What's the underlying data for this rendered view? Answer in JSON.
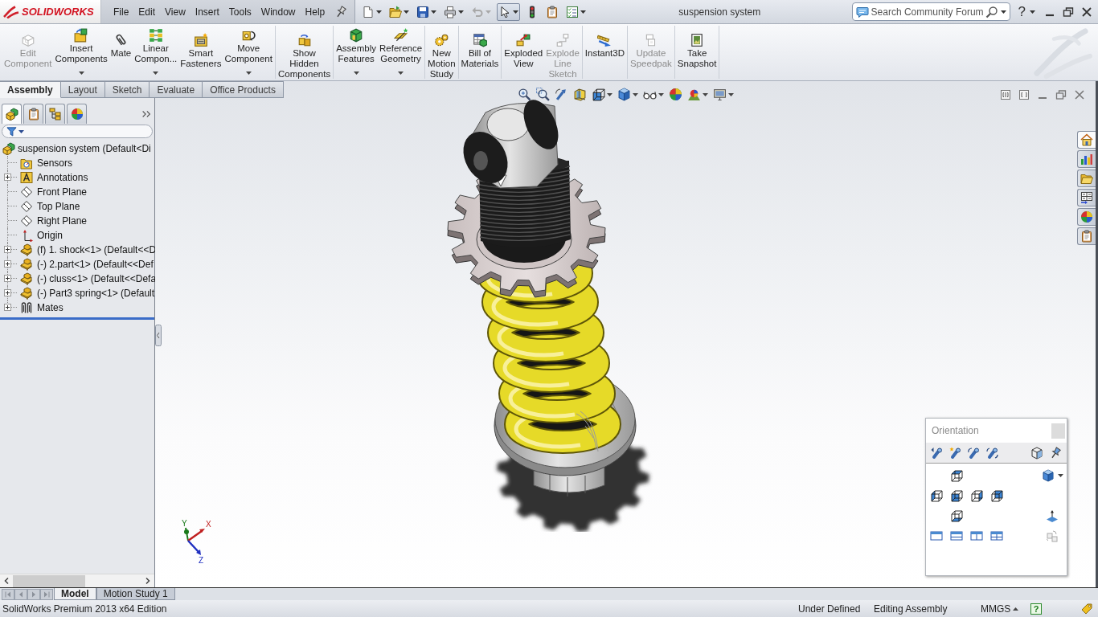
{
  "window": {
    "logo": "SOLIDWORKS",
    "title": "suspension system",
    "help": "?"
  },
  "menu": [
    "File",
    "Edit",
    "View",
    "Insert",
    "Tools",
    "Window",
    "Help"
  ],
  "quick_access": [
    {
      "kind": "new",
      "dropdown": true,
      "disabled": false,
      "pressed": false
    },
    {
      "kind": "open",
      "dropdown": true,
      "disabled": false,
      "pressed": false
    },
    {
      "kind": "save",
      "dropdown": true,
      "disabled": false,
      "pressed": false
    },
    {
      "kind": "print",
      "dropdown": true,
      "disabled": false,
      "pressed": false
    },
    {
      "kind": "undo",
      "dropdown": true,
      "disabled": true,
      "pressed": false
    },
    {
      "kind": "select",
      "dropdown": true,
      "disabled": false,
      "pressed": true
    },
    {
      "kind": "rebuild",
      "dropdown": false,
      "disabled": false,
      "pressed": false
    },
    {
      "kind": "file-properties",
      "dropdown": false,
      "disabled": false,
      "pressed": false
    },
    {
      "kind": "options",
      "dropdown": true,
      "disabled": false,
      "pressed": false
    }
  ],
  "search": {
    "placeholder": "Search Community Forum"
  },
  "ribbon": {
    "groups": [
      [
        {
          "kind": "edit-component",
          "label": "Edit\nComponent",
          "disabled": true,
          "dropdown": false
        },
        {
          "kind": "insert-components",
          "label": "Insert\nComponents",
          "disabled": false,
          "dropdown": true
        },
        {
          "kind": "mate",
          "label": "Mate",
          "disabled": false,
          "dropdown": false
        },
        {
          "kind": "linear-pattern",
          "label": "Linear\nCompon...",
          "disabled": false,
          "dropdown": true
        },
        {
          "kind": "smart-fasteners",
          "label": "Smart\nFasteners",
          "disabled": false,
          "dropdown": false
        },
        {
          "kind": "move-component",
          "label": "Move\nComponent",
          "disabled": false,
          "dropdown": true
        }
      ],
      [
        {
          "kind": "show-hidden",
          "label": "Show\nHidden\nComponents",
          "disabled": false,
          "dropdown": false
        }
      ],
      [
        {
          "kind": "assembly-features",
          "label": "Assembly\nFeatures",
          "disabled": false,
          "dropdown": true
        },
        {
          "kind": "reference-geometry",
          "label": "Reference\nGeometry",
          "disabled": false,
          "dropdown": true
        }
      ],
      [
        {
          "kind": "new-motion-study",
          "label": "New\nMotion\nStudy",
          "disabled": false,
          "dropdown": false
        }
      ],
      [
        {
          "kind": "bill-of-materials",
          "label": "Bill of\nMaterials",
          "disabled": false,
          "dropdown": false
        }
      ],
      [
        {
          "kind": "exploded-view",
          "label": "Exploded\nView",
          "disabled": false,
          "dropdown": false
        },
        {
          "kind": "explode-line-sketch",
          "label": "Explode\nLine\nSketch",
          "disabled": true,
          "dropdown": false
        }
      ],
      [
        {
          "kind": "instant3d",
          "label": "Instant3D",
          "disabled": false,
          "dropdown": false
        }
      ],
      [
        {
          "kind": "update-speedpak",
          "label": "Update\nSpeedpak",
          "disabled": true,
          "dropdown": false
        }
      ],
      [
        {
          "kind": "take-snapshot",
          "label": "Take\nSnapshot",
          "disabled": false,
          "dropdown": false
        }
      ]
    ]
  },
  "command_tabs": [
    {
      "label": "Assembly",
      "selected": true
    },
    {
      "label": "Layout",
      "selected": false
    },
    {
      "label": "Sketch",
      "selected": false
    },
    {
      "label": "Evaluate",
      "selected": false
    },
    {
      "label": "Office Products",
      "selected": false
    }
  ],
  "panel_tabs": [
    {
      "kind": "feature-tree",
      "selected": true
    },
    {
      "kind": "property",
      "selected": false
    },
    {
      "kind": "configuration",
      "selected": false
    },
    {
      "kind": "display",
      "selected": false
    }
  ],
  "tree": {
    "label": "suspension system (Default<Di",
    "kind": "assembly",
    "children": [
      {
        "label": "Sensors",
        "kind": "sensors",
        "expandable": false
      },
      {
        "label": "Annotations",
        "kind": "annotations",
        "expandable": true
      },
      {
        "label": "Front Plane",
        "kind": "plane",
        "expandable": false
      },
      {
        "label": "Top Plane",
        "kind": "plane",
        "expandable": false
      },
      {
        "label": "Right Plane",
        "kind": "plane",
        "expandable": false
      },
      {
        "label": "Origin",
        "kind": "origin",
        "expandable": false
      },
      {
        "label": "(f) 1. shock<1> (Default<<D",
        "kind": "part",
        "expandable": true
      },
      {
        "label": "(-) 2.part<1> (Default<<Def",
        "kind": "part",
        "expandable": true
      },
      {
        "label": "(-) cluss<1> (Default<<Defa",
        "kind": "part",
        "expandable": true
      },
      {
        "label": "(-) Part3 spring<1> (Default",
        "kind": "part",
        "expandable": true
      },
      {
        "label": "Mates",
        "kind": "mates",
        "expandable": true
      }
    ]
  },
  "heads_up": [
    {
      "kind": "zoom-fit",
      "dropdown": false
    },
    {
      "kind": "zoom-area",
      "dropdown": false
    },
    {
      "kind": "previous-view",
      "dropdown": false
    },
    {
      "kind": "section-view",
      "dropdown": false
    },
    {
      "kind": "view-orientation",
      "dropdown": true
    },
    {
      "kind": "display-style",
      "dropdown": true
    },
    {
      "kind": "hide-show",
      "dropdown": true
    },
    {
      "kind": "appearance",
      "dropdown": false
    },
    {
      "kind": "scene",
      "dropdown": true
    },
    {
      "kind": "view-settings",
      "dropdown": true
    }
  ],
  "triad": {
    "x": "X",
    "y": "Y",
    "z": "Z"
  },
  "orientation": {
    "title": "Orientation"
  },
  "task_pane": [
    {
      "kind": "home",
      "selected": true
    },
    {
      "kind": "resources",
      "selected": false
    },
    {
      "kind": "library",
      "selected": false
    },
    {
      "kind": "view-palette",
      "selected": false
    },
    {
      "kind": "appearances",
      "selected": false
    },
    {
      "kind": "custom-properties",
      "selected": false
    }
  ],
  "bottom_tabs": [
    {
      "label": "Model",
      "selected": true
    },
    {
      "label": "Motion Study 1",
      "selected": false
    }
  ],
  "status": {
    "edition": "SolidWorks Premium 2013 x64 Edition",
    "state": "Under Defined",
    "mode": "Editing Assembly",
    "units": "MMGS",
    "help": "?"
  }
}
